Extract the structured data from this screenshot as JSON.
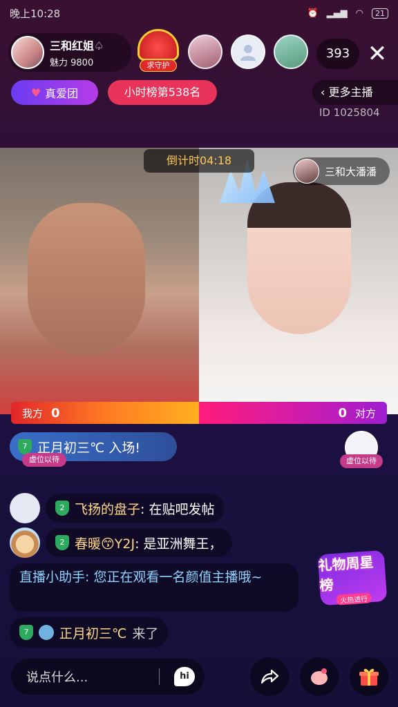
{
  "status_bar": {
    "time": "晚上10:28",
    "battery": "21"
  },
  "host": {
    "name": "三和红姐♤",
    "charm": "魅力 9800"
  },
  "guard": {
    "label": "求守护"
  },
  "viewers": {
    "count": "393"
  },
  "fan_club": {
    "label": "真爱团"
  },
  "rank": {
    "label": "小时榜第538名"
  },
  "more_hosts": {
    "label": "更多主播"
  },
  "room": {
    "id": "ID 1025804"
  },
  "pk": {
    "countdown": "倒计时04:18",
    "opponent_name": "三和大潘潘",
    "our_label": "我方",
    "our_score": "0",
    "their_label": "对方",
    "their_score": "0"
  },
  "entry_banner": {
    "level": "7",
    "text": "正月初三℃  入场!"
  },
  "seats": {
    "left_label": "虚位以待",
    "right_label": "虚位以待"
  },
  "chat": [
    {
      "level": "2",
      "user": "飞扬的盘子",
      "message": ": 在贴吧发帖"
    },
    {
      "level": "2",
      "user": "春暖😙Y2J",
      "message": ": 是亚洲舞王，"
    }
  ],
  "assistant": {
    "text": "直播小助手: 您正在观看一名颜值主播哦~"
  },
  "enter_notice": {
    "level": "7",
    "user": "正月初三℃",
    "verb": "来了"
  },
  "gift_week": {
    "title": "礼物周星榜",
    "sub": "火热进行"
  },
  "input": {
    "placeholder": "说点什么...",
    "hi": "hi"
  },
  "colors": {
    "pk_left": "#ff7a22",
    "pk_right": "#d41ca8",
    "rank": "#e8345a"
  }
}
